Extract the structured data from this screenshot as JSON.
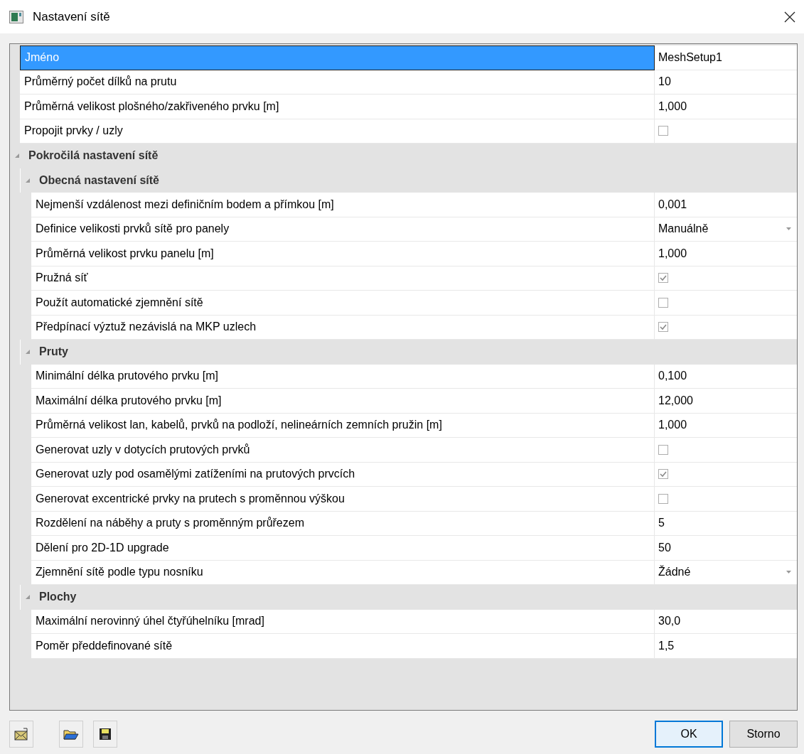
{
  "window": {
    "title": "Nastavení sítě"
  },
  "properties": [
    {
      "label": "Jméno",
      "kind": "text",
      "value": "MeshSetup1",
      "selected": true
    },
    {
      "label": "Průměrný počet dílků na prutu",
      "kind": "text",
      "value": "10",
      "selected": false
    },
    {
      "label": "Průměrná velikost plošného/zakřiveného prvku [m]",
      "kind": "text",
      "value": "1,000",
      "selected": false
    },
    {
      "label": "Propojit prvky / uzly",
      "kind": "checkbox",
      "checked": false,
      "selected": false
    }
  ],
  "sections": [
    {
      "title": "Pokročilá nastavení sítě",
      "expanded": true,
      "children": [
        {
          "title": "Obecná nastavení sítě",
          "expanded": true,
          "rows": [
            {
              "label": "Nejmenší vzdálenost mezi definičním bodem a přímkou [m]",
              "kind": "text",
              "value": "0,001",
              "selected": false
            },
            {
              "label": "Definice velikosti prvků sítě pro panely",
              "kind": "dropdown",
              "value": "Manuálně",
              "selected": false
            },
            {
              "label": "Průměrná velikost prvku panelu [m]",
              "kind": "text",
              "value": "1,000",
              "selected": false
            },
            {
              "label": "Pružná síť",
              "kind": "checkbox",
              "checked": true,
              "selected": false
            },
            {
              "label": "Použít automatické zjemnění sítě",
              "kind": "checkbox",
              "checked": false,
              "selected": false
            },
            {
              "label": "Předpínací výztuž nezávislá na MKP uzlech",
              "kind": "checkbox",
              "checked": true,
              "selected": false
            }
          ]
        },
        {
          "title": "Pruty",
          "expanded": true,
          "rows": [
            {
              "label": "Minimální délka prutového prvku [m]",
              "kind": "text",
              "value": "0,100",
              "selected": false
            },
            {
              "label": "Maximální délka prutového prvku [m]",
              "kind": "text",
              "value": "12,000",
              "selected": false
            },
            {
              "label": "Průměrná velikost lan, kabelů, prvků na podloží, nelineárních zemních pružin [m]",
              "kind": "text",
              "value": "1,000",
              "selected": false
            },
            {
              "label": "Generovat uzly v dotycích prutových prvků",
              "kind": "checkbox",
              "checked": false,
              "selected": false
            },
            {
              "label": "Generovat uzly pod osamělými zatíženími na prutových prvcích",
              "kind": "checkbox",
              "checked": true,
              "selected": false
            },
            {
              "label": "Generovat excentrické prvky na prutech s proměnnou výškou",
              "kind": "checkbox",
              "checked": false,
              "selected": false
            },
            {
              "label": "Rozdělení na náběhy a pruty s proměnným průřezem",
              "kind": "text",
              "value": "5",
              "selected": false
            },
            {
              "label": "Dělení pro 2D-1D upgrade",
              "kind": "text",
              "value": "50",
              "selected": false
            },
            {
              "label": "Zjemnění sítě podle typu nosníku",
              "kind": "dropdown",
              "value": "Žádné",
              "selected": false
            }
          ]
        },
        {
          "title": "Plochy",
          "expanded": true,
          "rows": [
            {
              "label": "Maximální nerovinný úhel čtyřúhelníku [mrad]",
              "kind": "text",
              "value": "30,0",
              "selected": false
            },
            {
              "label": "Poměr předdefinované sítě",
              "kind": "text",
              "value": "1,5",
              "selected": false
            }
          ]
        }
      ]
    }
  ],
  "buttons": [
    "OK",
    "Storno"
  ]
}
